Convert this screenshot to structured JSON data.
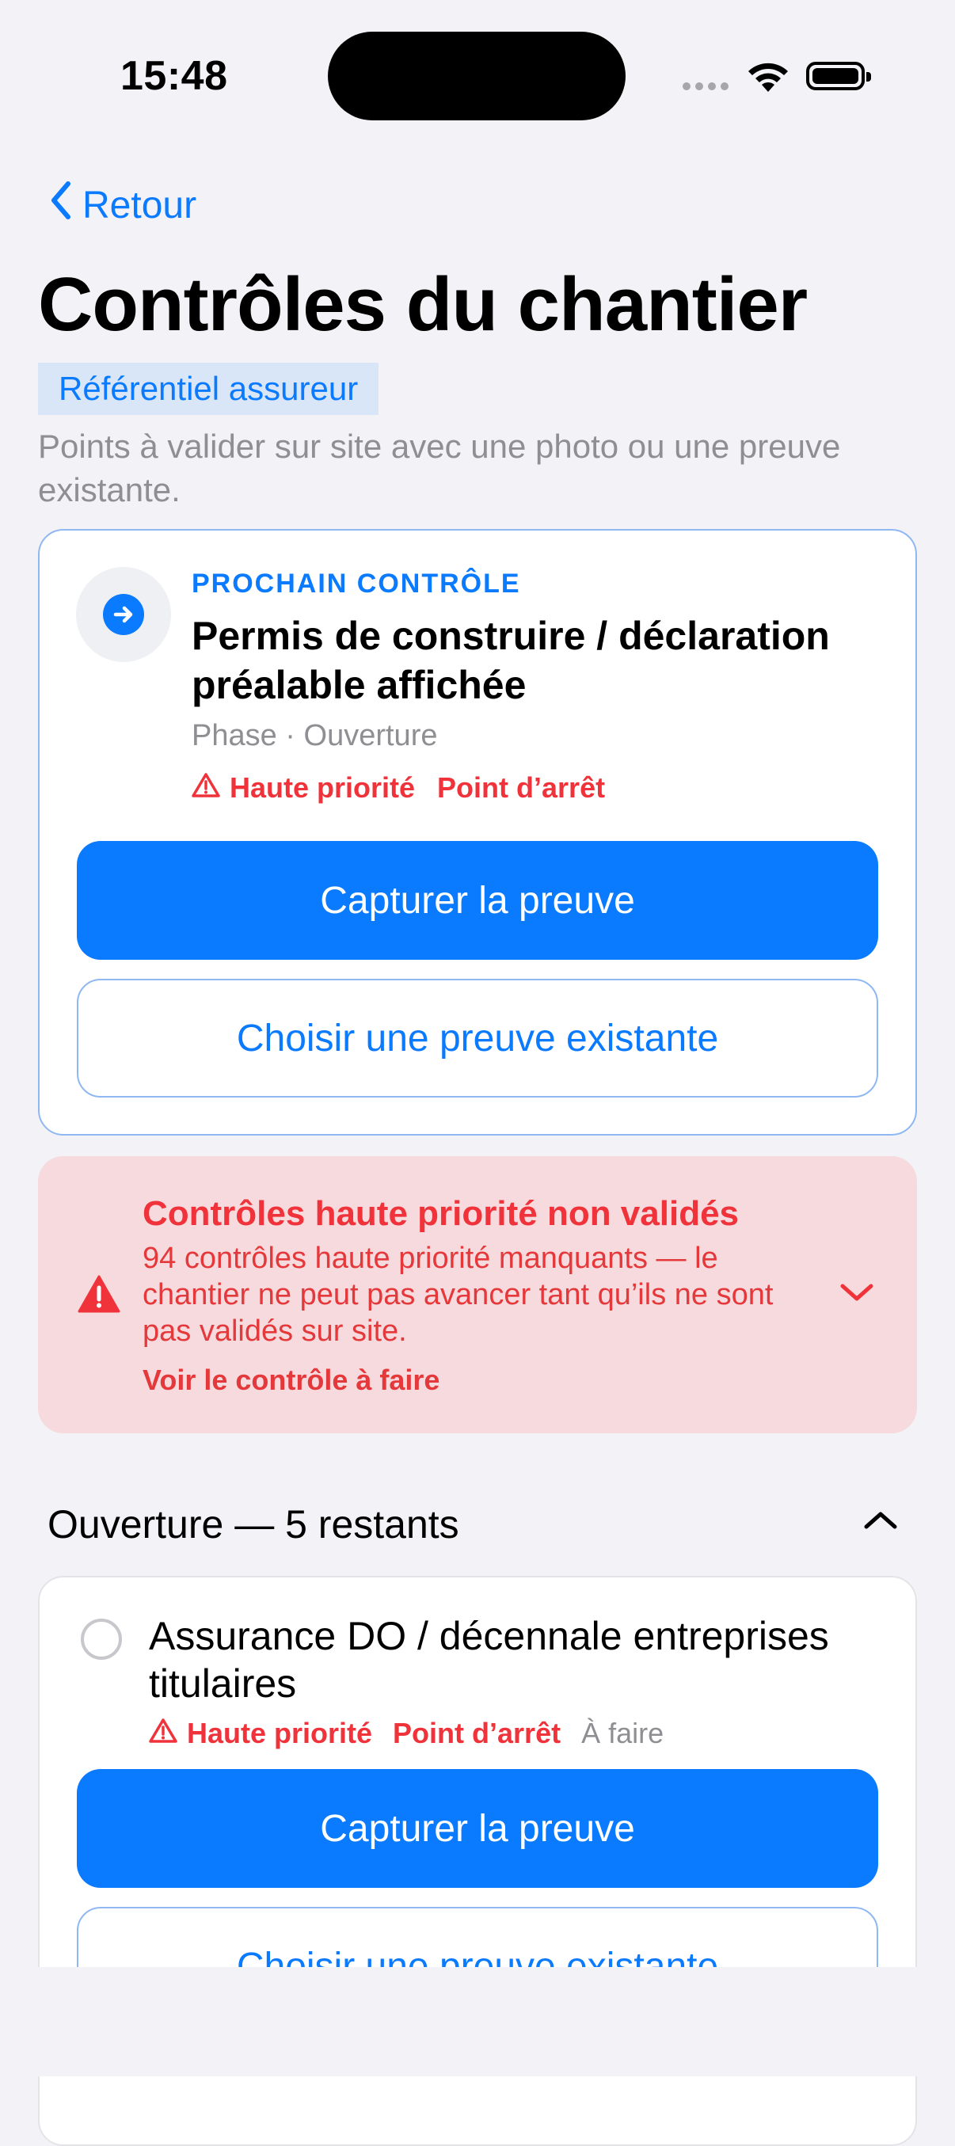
{
  "status_bar": {
    "time": "15:48"
  },
  "nav": {
    "back_label": "Retour"
  },
  "header": {
    "title": "Contrôles du chantier",
    "tag": "Référentiel assureur",
    "subtitle": "Points à valider sur site avec une photo ou une preuve existante."
  },
  "next_control": {
    "eyebrow": "PROCHAIN CONTRÔLE",
    "title": "Permis de construire / déclaration préalable affichée",
    "phase": "Phase · Ouverture",
    "priority": "Haute priorité",
    "stop_point": "Point d’arrêt",
    "capture_label": "Capturer la preuve",
    "choose_label": "Choisir une preuve existante"
  },
  "alert": {
    "title": "Contrôles haute priorité non validés",
    "body": "94 contrôles haute priorité manquants — le chantier ne peut pas avancer tant qu’ils ne sont pas validés sur site.",
    "link": "Voir le contrôle à faire"
  },
  "section": {
    "title": "Ouverture — 5 restants",
    "items": [
      {
        "title": "Assurance DO / décennale entreprises titulaires",
        "priority": "Haute priorité",
        "stop_point": "Point d’arrêt",
        "status": "À faire",
        "capture_label": "Capturer la preuve",
        "choose_label": "Choisir une preuve existante"
      }
    ]
  },
  "colors": {
    "accent": "#0A7AFF",
    "danger": "#F0333A",
    "alert_bg": "#F6DADD",
    "background": "#F2F2F7"
  },
  "icons": [
    "chevron-left-icon",
    "arrow-right-icon",
    "warning-icon",
    "chevron-down-icon",
    "chevron-up-icon",
    "wifi-icon",
    "battery-icon"
  ]
}
